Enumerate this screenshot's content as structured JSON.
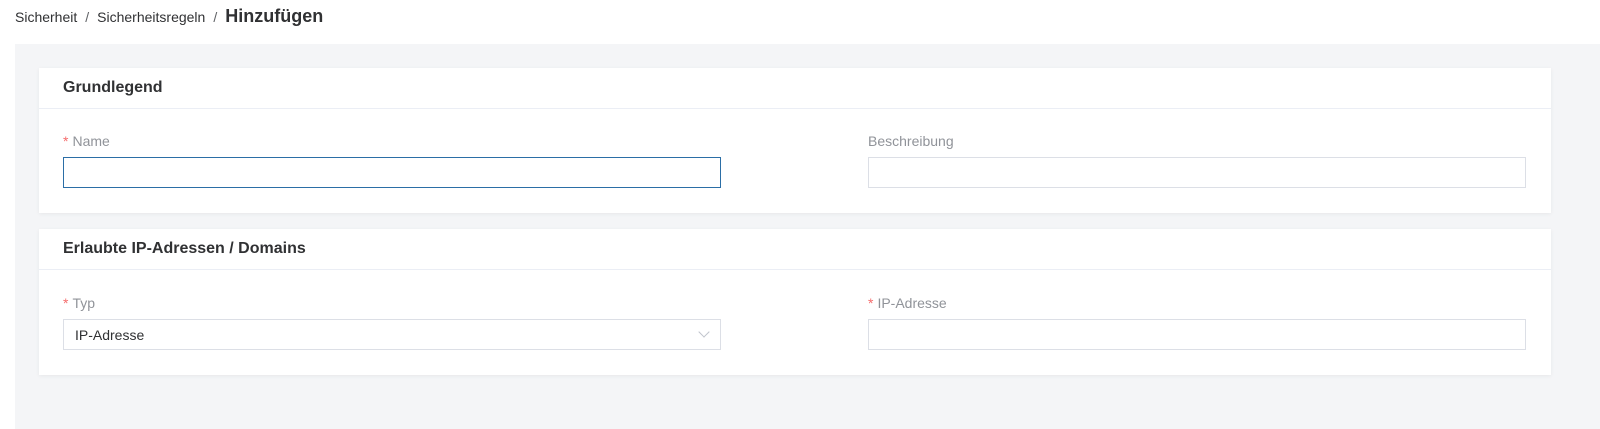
{
  "breadcrumb": {
    "items": [
      "Sicherheit",
      "Sicherheitsregeln"
    ],
    "separator": "/",
    "current": "Hinzufügen"
  },
  "section_basic": {
    "title": "Grundlegend",
    "name": {
      "label": "Name",
      "required_mark": "*",
      "value": ""
    },
    "description": {
      "label": "Beschreibung",
      "value": ""
    }
  },
  "section_allowed": {
    "title": "Erlaubte IP-Adressen / Domains",
    "type": {
      "label": "Typ",
      "required_mark": "*",
      "selected": "IP-Adresse"
    },
    "ip": {
      "label": "IP-Adresse",
      "required_mark": "*",
      "value": ""
    }
  },
  "colors": {
    "required": "#f56c6c",
    "focus_border": "#2b6ea6",
    "page_background": "#f4f5f7"
  },
  "icons": {
    "select_arrow": "chevron-down-icon"
  }
}
